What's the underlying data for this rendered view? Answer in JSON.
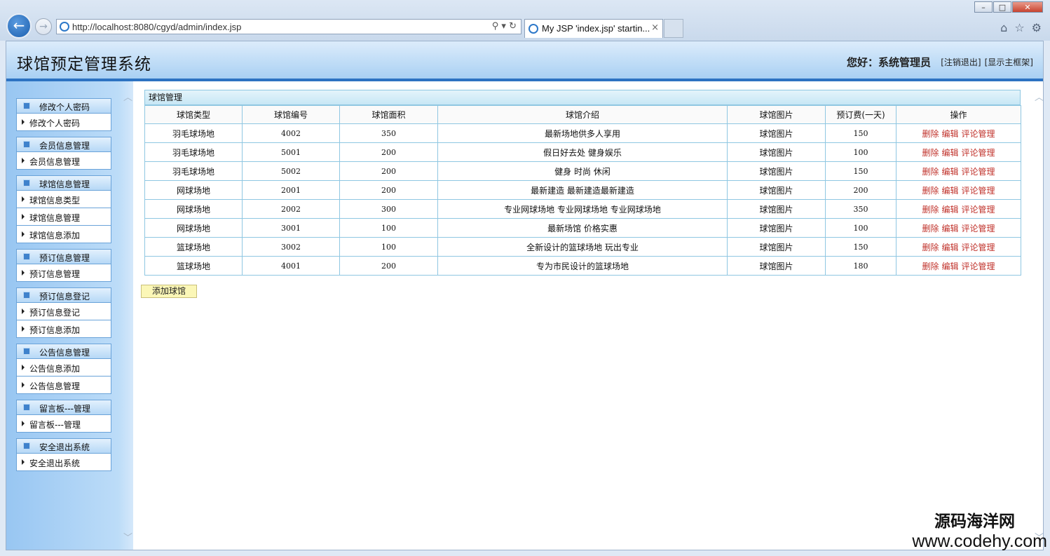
{
  "browser": {
    "url": "http://localhost:8080/cgyd/admin/index.jsp",
    "tab_title": "My JSP 'index.jsp' startin...",
    "close_glyph": "×"
  },
  "header": {
    "title": "球馆预定管理系统",
    "greeting": "您好：系统管理员",
    "logout": "[注销退出]",
    "show_frame": "[显示主框架]"
  },
  "sidebar": {
    "groups": [
      {
        "head": "修改个人密码",
        "items": [
          "修改个人密码"
        ]
      },
      {
        "head": "会员信息管理",
        "items": [
          "会员信息管理"
        ]
      },
      {
        "head": "球馆信息管理",
        "items": [
          "球馆信息类型",
          "球馆信息管理",
          "球馆信息添加"
        ]
      },
      {
        "head": "预订信息管理",
        "items": [
          "预订信息管理"
        ]
      },
      {
        "head": "预订信息登记",
        "items": [
          "预订信息登记",
          "预订信息添加"
        ]
      },
      {
        "head": "公告信息管理",
        "items": [
          "公告信息添加",
          "公告信息管理"
        ]
      },
      {
        "head": "留言板---管理",
        "items": [
          "留言板---管理"
        ]
      },
      {
        "head": "安全退出系统",
        "items": [
          "安全退出系统"
        ]
      }
    ]
  },
  "panel": {
    "title": "球馆管理",
    "columns": [
      "球馆类型",
      "球馆编号",
      "球馆面积",
      "球馆介绍",
      "球馆图片",
      "预订费(一天)",
      "操作"
    ],
    "rows": [
      [
        "羽毛球场地",
        "4002",
        "350",
        "最新场地供多人享用",
        "球馆图片",
        "150"
      ],
      [
        "羽毛球场地",
        "5001",
        "200",
        "假日好去处  健身娱乐",
        "球馆图片",
        "100"
      ],
      [
        "羽毛球场地",
        "5002",
        "200",
        "健身  时尚  休闲",
        "球馆图片",
        "150"
      ],
      [
        "网球场地",
        "2001",
        "200",
        "最新建造  最新建造最新建造",
        "球馆图片",
        "200"
      ],
      [
        "网球场地",
        "2002",
        "300",
        "专业网球场地  专业网球场地  专业网球场地",
        "球馆图片",
        "350"
      ],
      [
        "网球场地",
        "3001",
        "100",
        "最新场馆  价格实惠",
        "球馆图片",
        "100"
      ],
      [
        "篮球场地",
        "3002",
        "100",
        "全新设计的篮球场地  玩出专业",
        "球馆图片",
        "150"
      ],
      [
        "篮球场地",
        "4001",
        "200",
        "专为市民设计的篮球场地",
        "球馆图片",
        "180"
      ]
    ],
    "actions": [
      "删除",
      "编辑",
      "评论管理"
    ],
    "add_button": "添加球馆"
  },
  "watermark": {
    "line1": "源码海洋网",
    "line2": "www.codehy.com"
  }
}
